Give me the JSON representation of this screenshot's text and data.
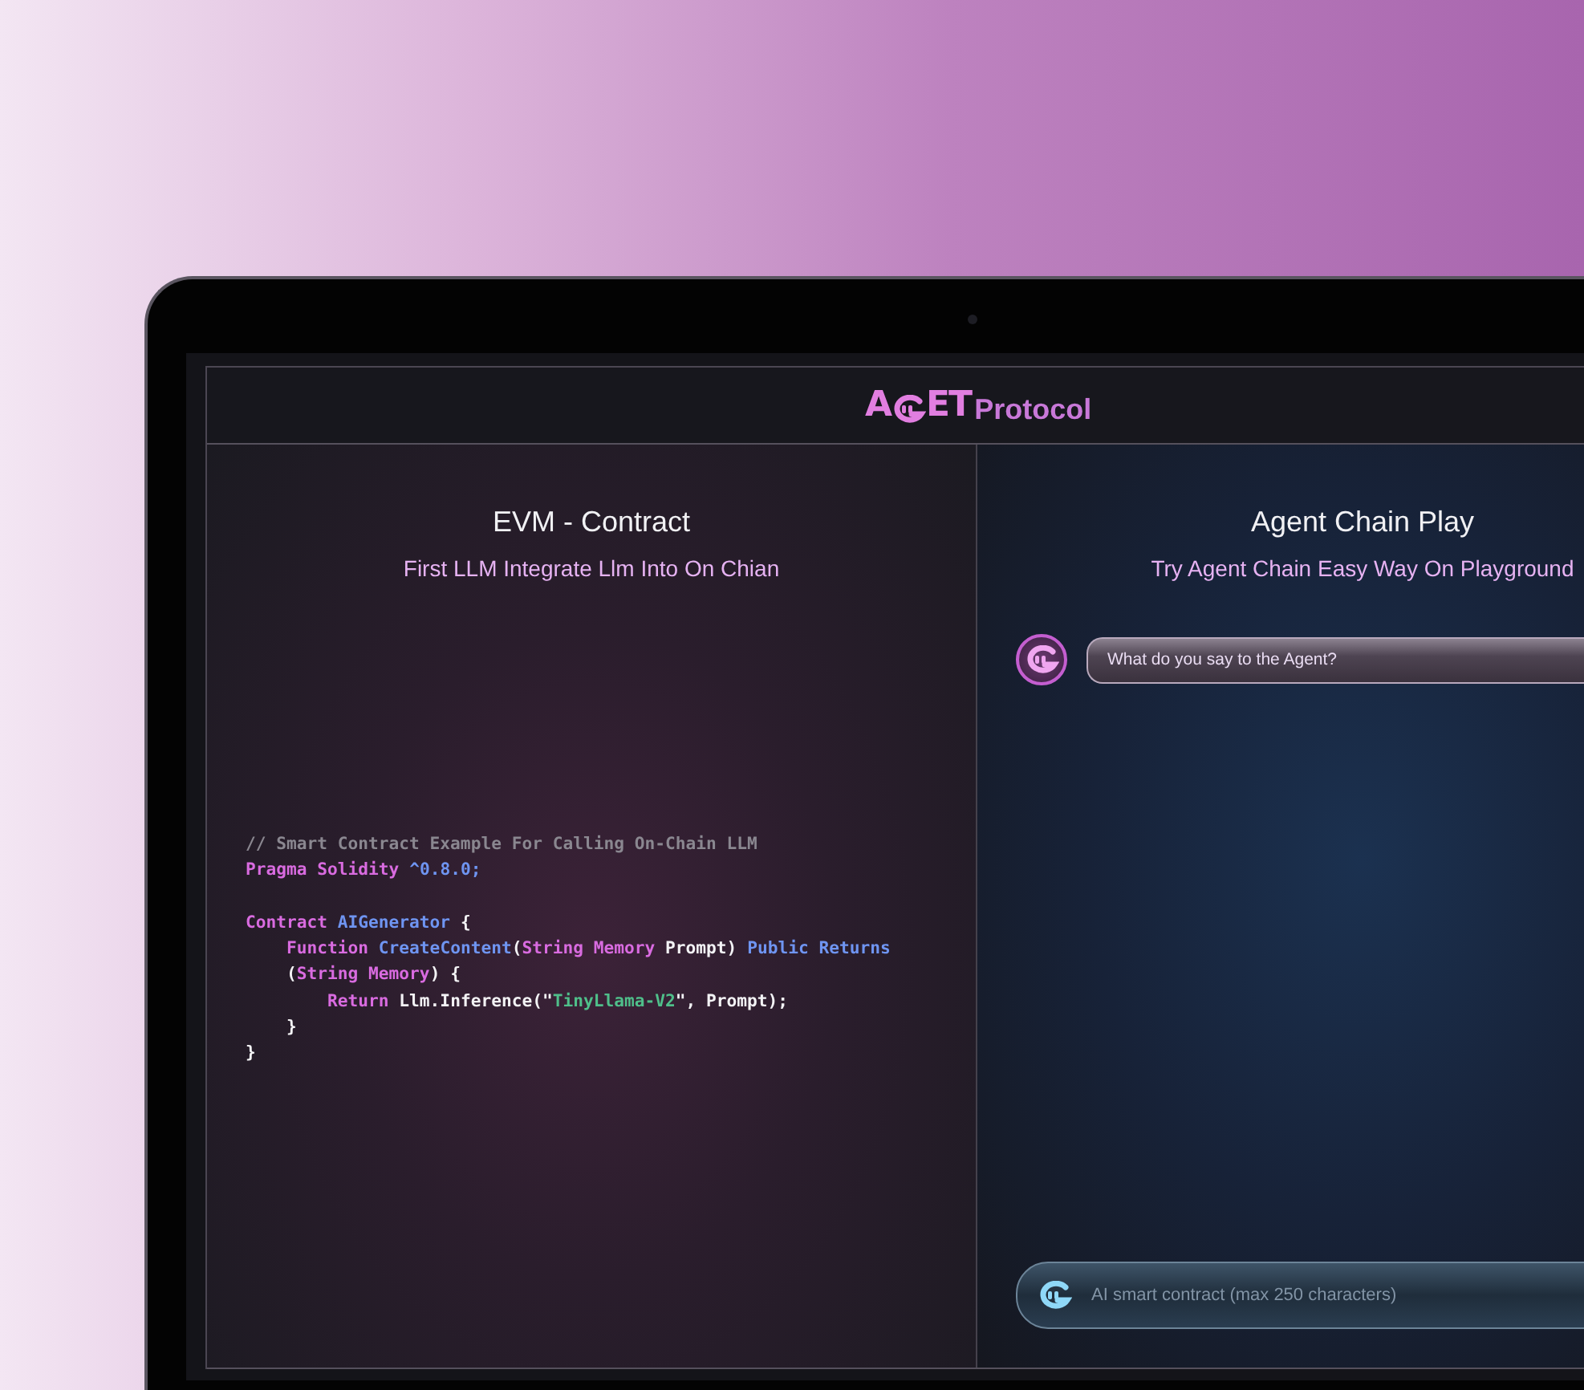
{
  "header": {
    "logo": {
      "prefix": "A",
      "suffix": "ET",
      "name": "Protocol"
    }
  },
  "contract_panel": {
    "title": "EVM - Contract",
    "subtitle": "First LLM Integrate Llm Into On Chian",
    "code": [
      [
        {
          "kind": "comment",
          "text": "// Smart Contract Example For Calling On-Chain LLM"
        }
      ],
      [
        {
          "kind": "keyword",
          "text": "Pragma Solidity "
        },
        {
          "kind": "type",
          "text": "^0.8.0;"
        }
      ],
      [
        {
          "kind": "keyword",
          "text": "Contract ",
          "spaced": true
        },
        {
          "kind": "type",
          "text": "AIGenerator"
        },
        {
          "kind": "plain",
          "text": " {"
        }
      ],
      [
        {
          "kind": "keyword",
          "text": "    Function "
        },
        {
          "kind": "type",
          "text": "CreateContent"
        },
        {
          "kind": "plain",
          "text": "("
        },
        {
          "kind": "keyword",
          "text": "String Memory"
        },
        {
          "kind": "plain",
          "text": " Prompt) "
        },
        {
          "kind": "type",
          "text": "Public Returns"
        }
      ],
      [
        {
          "kind": "plain",
          "text": "    ("
        },
        {
          "kind": "keyword",
          "text": "String Memory"
        },
        {
          "kind": "plain",
          "text": ") {"
        }
      ],
      [
        {
          "kind": "keyword",
          "text": "        Return"
        },
        {
          "kind": "plain",
          "text": " Llm.Inference(\""
        },
        {
          "kind": "string",
          "text": "TinyLlama-V2"
        },
        {
          "kind": "plain",
          "text": "\", Prompt);"
        }
      ],
      [
        {
          "kind": "plain",
          "text": "    }"
        }
      ],
      [
        {
          "kind": "plain",
          "text": "}"
        }
      ]
    ]
  },
  "play_panel": {
    "title": "Agent Chain Play",
    "subtitle": "Try Agent Chain Easy Way On Playground",
    "messages": [
      {
        "text": "What do you say to the Agent?"
      }
    ],
    "input": {
      "placeholder": "AI smart contract (max 250 characters)"
    }
  }
}
